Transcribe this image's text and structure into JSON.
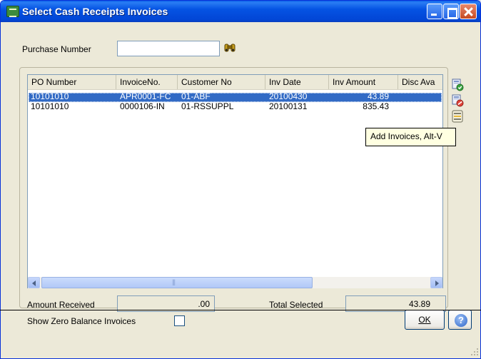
{
  "window": {
    "title": "Select Cash Receipts Invoices"
  },
  "search": {
    "label": "Purchase Number",
    "value": ""
  },
  "grid": {
    "columns": [
      "PO Number",
      "InvoiceNo.",
      "Customer No",
      "Inv Date",
      "Inv Amount",
      "Disc Ava"
    ],
    "rows": [
      {
        "po": "10101010",
        "invoice": "APR0001-FC",
        "customer": "01-ABF",
        "date": "20100430",
        "amount": "43.89",
        "selected": true
      },
      {
        "po": "10101010",
        "invoice": "0000106-IN",
        "customer": "01-RSSUPPL",
        "date": "20100131",
        "amount": "835.43",
        "selected": false
      }
    ]
  },
  "side_icons": [
    "add-invoices-icon",
    "remove-invoices-icon",
    "select-all-icon"
  ],
  "tooltip": {
    "text": "Add Invoices, Alt-V"
  },
  "totals": {
    "amount_received_label": "Amount Received",
    "amount_received_value": ".00",
    "total_selected_label": "Total Selected",
    "total_selected_value": "43.89"
  },
  "footer": {
    "show_zero_label": "Show Zero Balance Invoices",
    "show_zero_checked": false,
    "ok_label": "OK",
    "help_label": "?"
  },
  "background": {
    "left_fragment": "i"
  },
  "colors": {
    "titlebar": "#0553e3",
    "selection": "#316ac5",
    "tooltip_bg": "#ffffe1",
    "dialog_bg": "#ece9d8"
  }
}
